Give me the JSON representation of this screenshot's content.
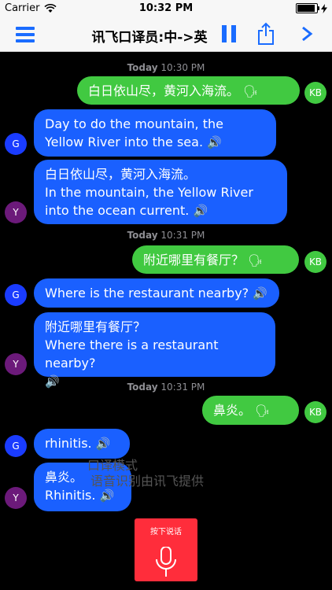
{
  "status_bar": {
    "carrier": "Carrier",
    "time": "10:32 PM"
  },
  "nav": {
    "title": "讯飞口译员:中->英"
  },
  "messages": [
    {
      "id": "ts1",
      "type": "timestamp",
      "day": "Today",
      "time": "10:30 PM"
    },
    {
      "id": "m1",
      "speaker": "KB",
      "text": "白日依山尽，黄河入海流。",
      "icon": "🗣"
    },
    {
      "id": "m2",
      "speaker": "G",
      "text": "Day to do the mountain, the Yellow River into the sea.",
      "icon": "🔊"
    },
    {
      "id": "m3",
      "speaker": "Y",
      "text_cn": "白日依山尽，黄河入海流。",
      "text_en": "In the mountain, the Yellow River into the ocean current.",
      "icon": "🔊"
    },
    {
      "id": "ts2",
      "type": "timestamp",
      "day": "Today",
      "time": "10:31 PM"
    },
    {
      "id": "m4",
      "speaker": "KB",
      "text": "附近哪里有餐厅？",
      "icon": "🗣"
    },
    {
      "id": "m5",
      "speaker": "G",
      "text": "Where is the restaurant nearby?",
      "icon": "🔊"
    },
    {
      "id": "m6",
      "speaker": "Y",
      "text_cn": "附近哪里有餐厅？",
      "text_en": "Where there is a restaurant nearby?",
      "icon": "🔊"
    },
    {
      "id": "ts3",
      "type": "timestamp",
      "day": "Today",
      "time": "10:31 PM"
    },
    {
      "id": "m7",
      "speaker": "KB",
      "text": "鼻炎。",
      "icon": "🗣"
    },
    {
      "id": "m8",
      "speaker": "G",
      "text": "rhinitis.",
      "icon": "🔊"
    },
    {
      "id": "m9",
      "speaker": "Y",
      "text_cn": "鼻炎。",
      "text_en": "Rhinitis.",
      "icon": "🔊"
    }
  ],
  "overlay": {
    "mode": "口译模式",
    "credit": "语音识别由讯飞提供"
  },
  "record_button": {
    "label": "按下说话"
  },
  "colors": {
    "accent": "#1a6cff",
    "green": "#41c941",
    "blue": "#1a60ff",
    "record": "#ff2d3b"
  }
}
